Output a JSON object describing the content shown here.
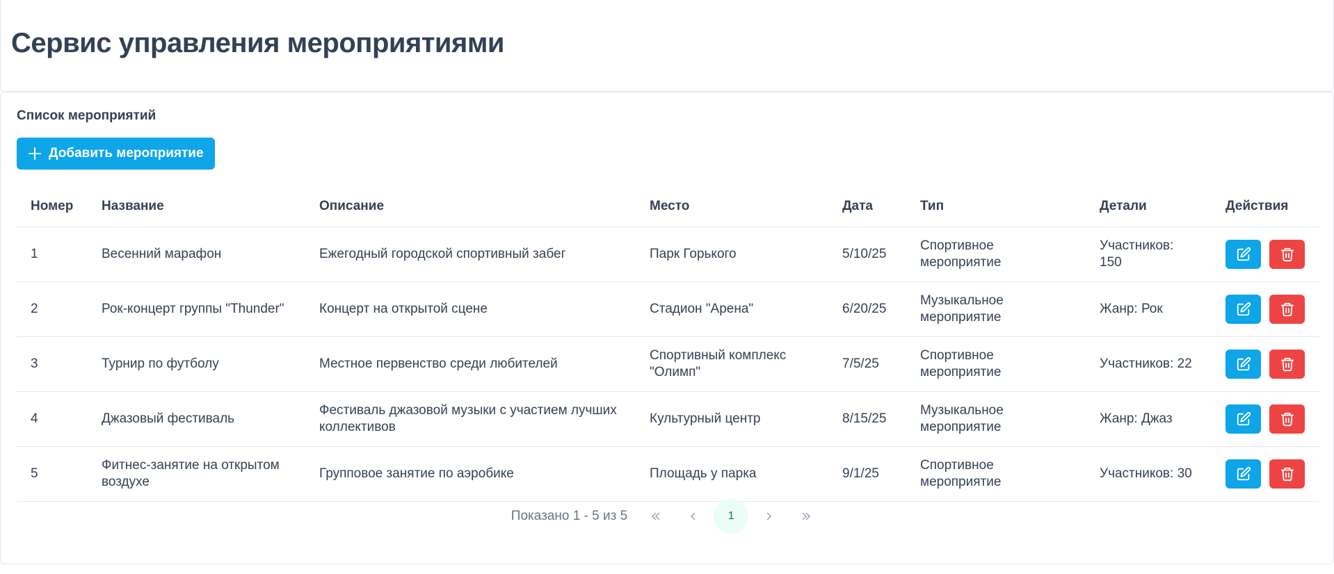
{
  "header": {
    "title": "Сервис управления мероприятиями"
  },
  "section": {
    "title": "Список мероприятий",
    "add_button_label": "Добавить мероприятие"
  },
  "table": {
    "columns": [
      "Номер",
      "Название",
      "Описание",
      "Место",
      "Дата",
      "Тип",
      "Детали",
      "Действия"
    ],
    "rows": [
      {
        "num": "1",
        "name": "Весенний марафон",
        "description": "Ежегодный городской спортивный забег",
        "place": "Парк Горького",
        "date": "5/10/25",
        "type": "Спортивное мероприятие",
        "details": "Участников: 150"
      },
      {
        "num": "2",
        "name": "Рок-концерт группы \"Thunder\"",
        "description": "Концерт на открытой сцене",
        "place": "Стадион \"Арена\"",
        "date": "6/20/25",
        "type": "Музыкальное мероприятие",
        "details": "Жанр: Рок"
      },
      {
        "num": "3",
        "name": "Турнир по футболу",
        "description": "Местное первенство среди любителей",
        "place": "Спортивный комплекс \"Олимп\"",
        "date": "7/5/25",
        "type": "Спортивное мероприятие",
        "details": "Участников: 22"
      },
      {
        "num": "4",
        "name": "Джазовый фестиваль",
        "description": "Фестиваль джазовой музыки с участием лучших коллективов",
        "place": "Культурный центр",
        "date": "8/15/25",
        "type": "Музыкальное мероприятие",
        "details": "Жанр: Джаз"
      },
      {
        "num": "5",
        "name": "Фитнес-занятие на открытом воздухе",
        "description": "Групповое занятие по аэробике",
        "place": "Площадь у парка",
        "date": "9/1/25",
        "type": "Спортивное мероприятие",
        "details": "Участников: 30"
      }
    ]
  },
  "pagination": {
    "summary": "Показано 1 - 5 из 5",
    "current_page": "1"
  },
  "icons": {
    "add": "plus-icon",
    "edit": "edit-icon",
    "delete": "trash-icon",
    "first": "double-chevron-left-icon",
    "prev": "chevron-left-icon",
    "next": "chevron-right-icon",
    "last": "double-chevron-right-icon"
  },
  "colors": {
    "primary": "#0ea5e9",
    "danger": "#ef4444",
    "text": "#334155",
    "active_page_bg": "#ecfdf5",
    "active_page_text": "#047857"
  }
}
